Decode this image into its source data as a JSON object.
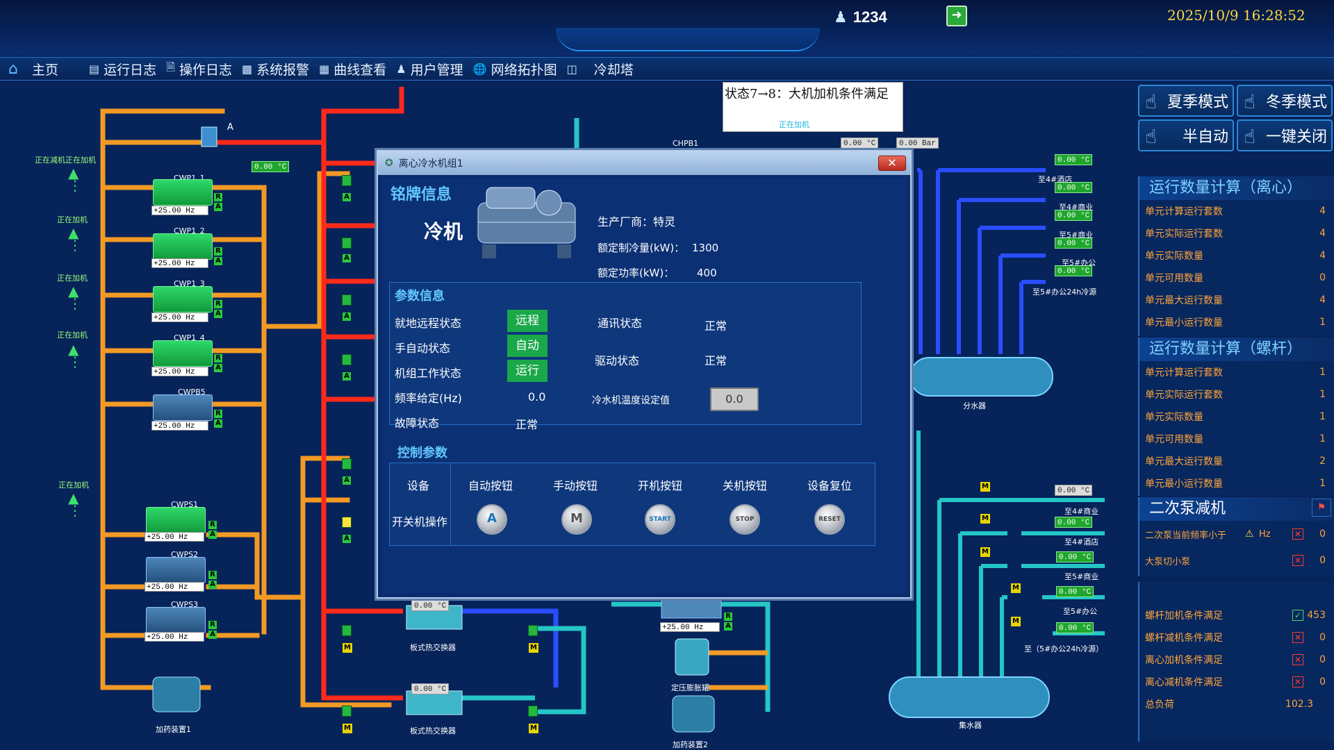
{
  "header": {
    "user_id": "1234",
    "datetime": "2025/10/9 16:28:52"
  },
  "nav": [
    {
      "icon": "home-icon",
      "label": "主页"
    },
    {
      "icon": "log-icon",
      "label": "运行日志"
    },
    {
      "icon": "doc-icon",
      "label": "操作日志"
    },
    {
      "icon": "alarm-icon",
      "label": "系统报警"
    },
    {
      "icon": "chart-icon",
      "label": "曲线查看"
    },
    {
      "icon": "user-icon",
      "label": "用户管理"
    },
    {
      "icon": "globe-icon",
      "label": "网络拓扑图"
    },
    {
      "icon": "tower-icon",
      "label": "冷却塔"
    }
  ],
  "status_note": {
    "text": "状态7→8：大机加机条件满足",
    "sub": "正在加机"
  },
  "mode_buttons": {
    "summer": "夏季模式",
    "winter": "冬季模式",
    "semi_auto": "半自动",
    "one_key_off": "一键关闭"
  },
  "panel_centrifugal": {
    "title": "运行数量计算（离心）",
    "rows": [
      {
        "k": "单元计算运行套数",
        "v": "4"
      },
      {
        "k": "单元实际运行套数",
        "v": "4"
      },
      {
        "k": "单元实际数量",
        "v": "4"
      },
      {
        "k": "单元可用数量",
        "v": "0"
      },
      {
        "k": "单元最大运行数量",
        "v": "4"
      },
      {
        "k": "单元最小运行数量",
        "v": "1"
      }
    ]
  },
  "panel_screw": {
    "title": "运行数量计算（螺杆）",
    "rows": [
      {
        "k": "单元计算运行套数",
        "v": "1"
      },
      {
        "k": "单元实际运行套数",
        "v": "1"
      },
      {
        "k": "单元实际数量",
        "v": "1"
      },
      {
        "k": "单元可用数量",
        "v": "1"
      },
      {
        "k": "单元最大运行数量",
        "v": "2"
      },
      {
        "k": "单元最小运行数量",
        "v": "1"
      }
    ]
  },
  "panel_secondary": {
    "title": "二次泵减机",
    "freq_label": "二次泵当前频率小于",
    "freq_unit": "Hz",
    "freq_value": "0",
    "big_small_label": "大泵切小泵",
    "big_small_value": "0"
  },
  "panel_conditions": {
    "rows": [
      {
        "k": "螺杆加机条件满足",
        "v": "453",
        "ok": true
      },
      {
        "k": "螺杆减机条件满足",
        "v": "0",
        "ok": false
      },
      {
        "k": "离心加机条件满足",
        "v": "0",
        "ok": false
      },
      {
        "k": "离心减机条件满足",
        "v": "0",
        "ok": false
      },
      {
        "k": "总负荷",
        "v": "102.3",
        "ok": null
      }
    ]
  },
  "diagram": {
    "pumps": [
      {
        "name": "CWP1_1",
        "hz": "+25.00",
        "unit": "Hz",
        "on": true
      },
      {
        "name": "CWP1_2",
        "hz": "+25.00",
        "unit": "Hz",
        "on": true
      },
      {
        "name": "CWP1_3",
        "hz": "+25.00",
        "unit": "Hz",
        "on": true
      },
      {
        "name": "CWP1_4",
        "hz": "+25.00",
        "unit": "Hz",
        "on": true
      },
      {
        "name": "CWPB5",
        "hz": "+25.00",
        "unit": "Hz",
        "on": false
      },
      {
        "name": "CWPS1",
        "hz": "+25.00",
        "unit": "Hz",
        "on": true
      },
      {
        "name": "CWPS2",
        "hz": "+25.00",
        "unit": "Hz",
        "on": false
      },
      {
        "name": "CWPS3",
        "hz": "+25.00",
        "unit": "Hz",
        "on": false
      }
    ],
    "adding_labels": [
      "正在减机正在加机",
      "正在加机",
      "正在加机",
      "正在加机",
      "正在加机"
    ],
    "temp_inlet": "0.00",
    "temp_unit": "°C",
    "chpb1_label": "CHPB1",
    "chpb1_value": "0.00",
    "pressure_value": "0.00",
    "pressure_unit": "Bar",
    "hx1_temp": "0.00",
    "hx2_temp": "0.00",
    "hx_label": "板式热交换器",
    "dosing1": "加药装置1",
    "dosing2": "加药装置2",
    "expansion": "定压膨胀罐",
    "secondary_pump_hz": "+25.00",
    "supply_header": "分水器",
    "return_header": "集水器",
    "supply_branches": [
      {
        "temp": "0.00",
        "label": ""
      },
      {
        "temp": "0.00",
        "label": "至4#酒店"
      },
      {
        "temp": "0.00",
        "label": "至4#商业"
      },
      {
        "temp": "0.00",
        "label": "至5#商业"
      },
      {
        "temp": "0.00",
        "label": "至5#办公"
      }
    ],
    "supply_last_label": "至5#办公24h冷源",
    "return_branches": [
      {
        "temp": "0.00",
        "label": "至4#商业"
      },
      {
        "temp": "0.00",
        "label": "至4#酒店"
      },
      {
        "temp": "0.00",
        "label": "至5#商业"
      },
      {
        "temp": "0.00",
        "label": "至5#办公"
      },
      {
        "temp": "0.00",
        "label": "至（5#办公24h冷源）"
      }
    ],
    "valve_letter_a": "A",
    "valve_letter_m": "M",
    "valve_letter_r": "R"
  },
  "dialog": {
    "title": "离心冷水机组1",
    "nameplate_title": "铭牌信息",
    "device_name": "冷机",
    "manufacturer_label": "生产厂商：",
    "manufacturer": "特灵",
    "rated_cooling_label": "额定制冷量(kW)：",
    "rated_cooling": "1300",
    "rated_power_label": "额定功率(kW)：",
    "rated_power": "400",
    "params_title": "参数信息",
    "local_remote_label": "就地远程状态",
    "local_remote": "远程",
    "manual_auto_label": "手自动状态",
    "manual_auto": "自动",
    "work_state_label": "机组工作状态",
    "work_state": "运行",
    "freq_set_label": "频率给定(Hz)",
    "freq_set": "0.0",
    "fault_label": "故障状态",
    "fault": "正常",
    "comm_label": "通讯状态",
    "comm": "正常",
    "drive_label": "驱动状态",
    "drive": "正常",
    "temp_set_label": "冷水机温度设定值",
    "temp_set": "0.0",
    "control_title": "控制参数",
    "device_col": "设备",
    "switch_row": "开关机操作",
    "buttons": [
      {
        "label": "自动按钮",
        "glyph": "A"
      },
      {
        "label": "手动按钮",
        "glyph": "M"
      },
      {
        "label": "开机按钮",
        "glyph": "START"
      },
      {
        "label": "关机按钮",
        "glyph": "STOP"
      },
      {
        "label": "设备复位",
        "glyph": "RESET"
      }
    ]
  },
  "colors": {
    "background": "#06235a",
    "hot_pipe": "#ff2a1a",
    "cooling_pipe": "#f29a24",
    "chilled_supply": "#2a4dff",
    "chilled_return": "#25c6c6",
    "accent_text": "#ffa53a",
    "title_text": "#7ed3ff",
    "datetime": "#ffd740"
  }
}
